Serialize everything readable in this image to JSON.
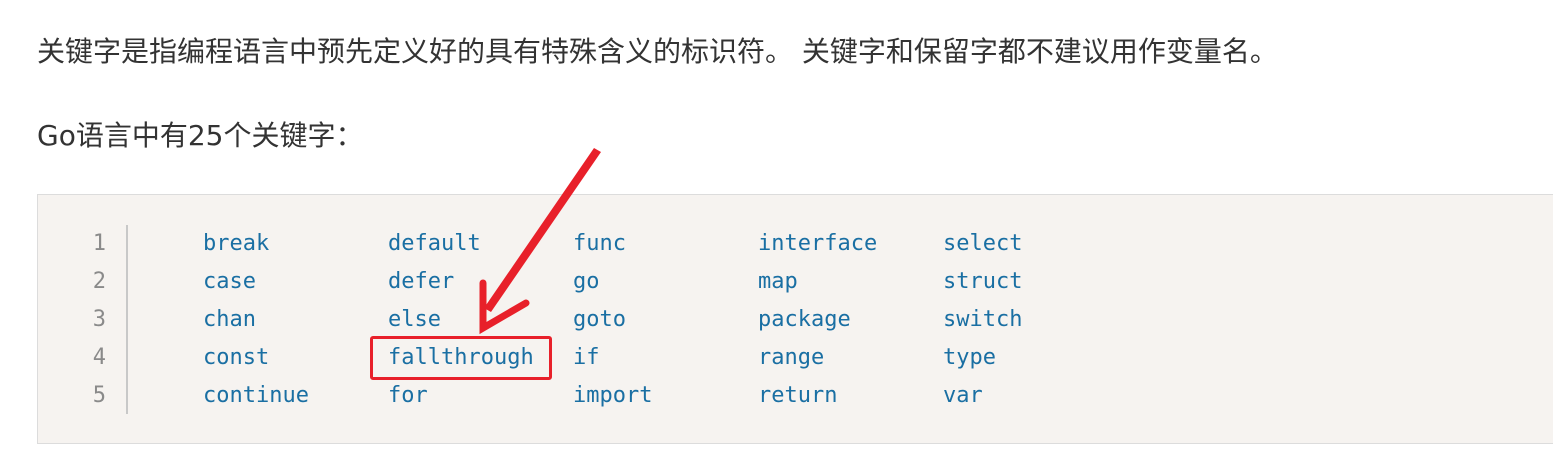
{
  "paragraphs": {
    "intro": "关键字是指编程语言中预先定义好的具有特殊含义的标识符。 关键字和保留字都不建议用作变量名。",
    "count": "Go语言中有25个关键字："
  },
  "code": {
    "line_numbers": [
      "1",
      "2",
      "3",
      "4",
      "5"
    ],
    "rows": [
      [
        "break",
        "default",
        "func",
        "interface",
        "select"
      ],
      [
        "case",
        "defer",
        "go",
        "map",
        "struct"
      ],
      [
        "chan",
        "else",
        "goto",
        "package",
        "switch"
      ],
      [
        "const",
        "fallthrough",
        "if",
        "range",
        "type"
      ],
      [
        "continue",
        "for",
        "import",
        "return",
        "var"
      ]
    ],
    "highlighted_keyword": "fallthrough"
  },
  "colors": {
    "keyword": "#1a6fa3",
    "annotation": "#e8202a",
    "code_background": "#f6f3f0"
  }
}
